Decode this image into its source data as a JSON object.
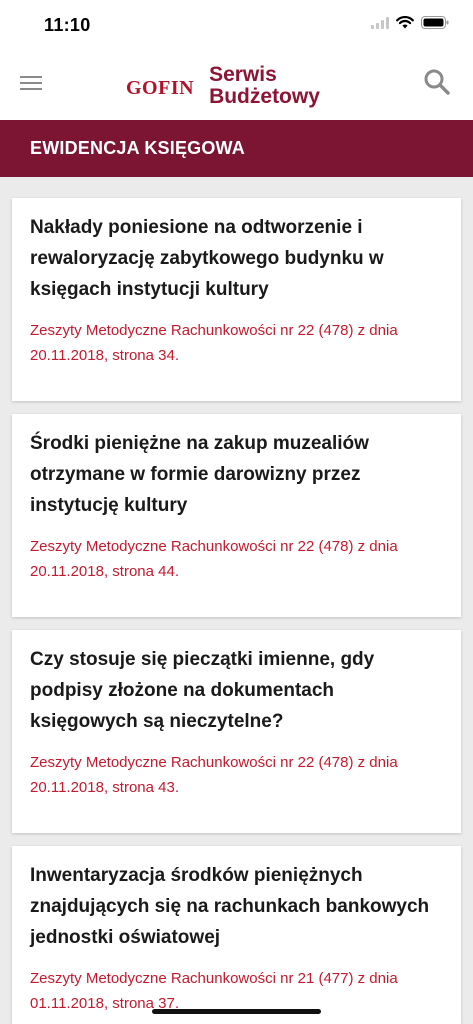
{
  "status_bar": {
    "time": "11:10",
    "icons": [
      "signal-icon",
      "wifi-icon",
      "battery-icon"
    ]
  },
  "header": {
    "menu_icon": "menu-icon",
    "logo_brand": "GOFIN",
    "logo_line1": "Serwis",
    "logo_line2": "Budżetowy",
    "search_icon": "search-icon"
  },
  "section": {
    "title": "EWIDENCJA KSIĘGOWA"
  },
  "articles": [
    {
      "title": "Nakłady poniesione na odtworzenie i rewaloryzację zabytkowego budynku w księgach instytucji kultury",
      "source": "Zeszyty Metodyczne Rachunkowości nr 22 (478) z dnia 20.11.2018, strona 34."
    },
    {
      "title": "Środki pieniężne na zakup muzealiów otrzymane w formie darowizny przez instytucję kultury",
      "source": "Zeszyty Metodyczne Rachunkowości nr 22 (478) z dnia 20.11.2018, strona 44."
    },
    {
      "title": "Czy stosuje się pieczątki imienne, gdy podpisy złożone na dokumentach księgowych są nieczytelne?",
      "source": "Zeszyty Metodyczne Rachunkowości nr 22 (478) z dnia 20.11.2018, strona 43."
    },
    {
      "title": "Inwentaryzacja środków pieniężnych znajdujących się na rachunkach bankowych jednostki oświatowej",
      "source": "Zeszyty Metodyczne Rachunkowości nr 21 (477) z dnia 01.11.2018, strona 37."
    }
  ],
  "colors": {
    "brand_red": "#b0142b",
    "brand_maroon": "#8c1434",
    "section_bar": "#7c1433",
    "source_text": "#c51a2e",
    "background": "#ebebeb"
  }
}
